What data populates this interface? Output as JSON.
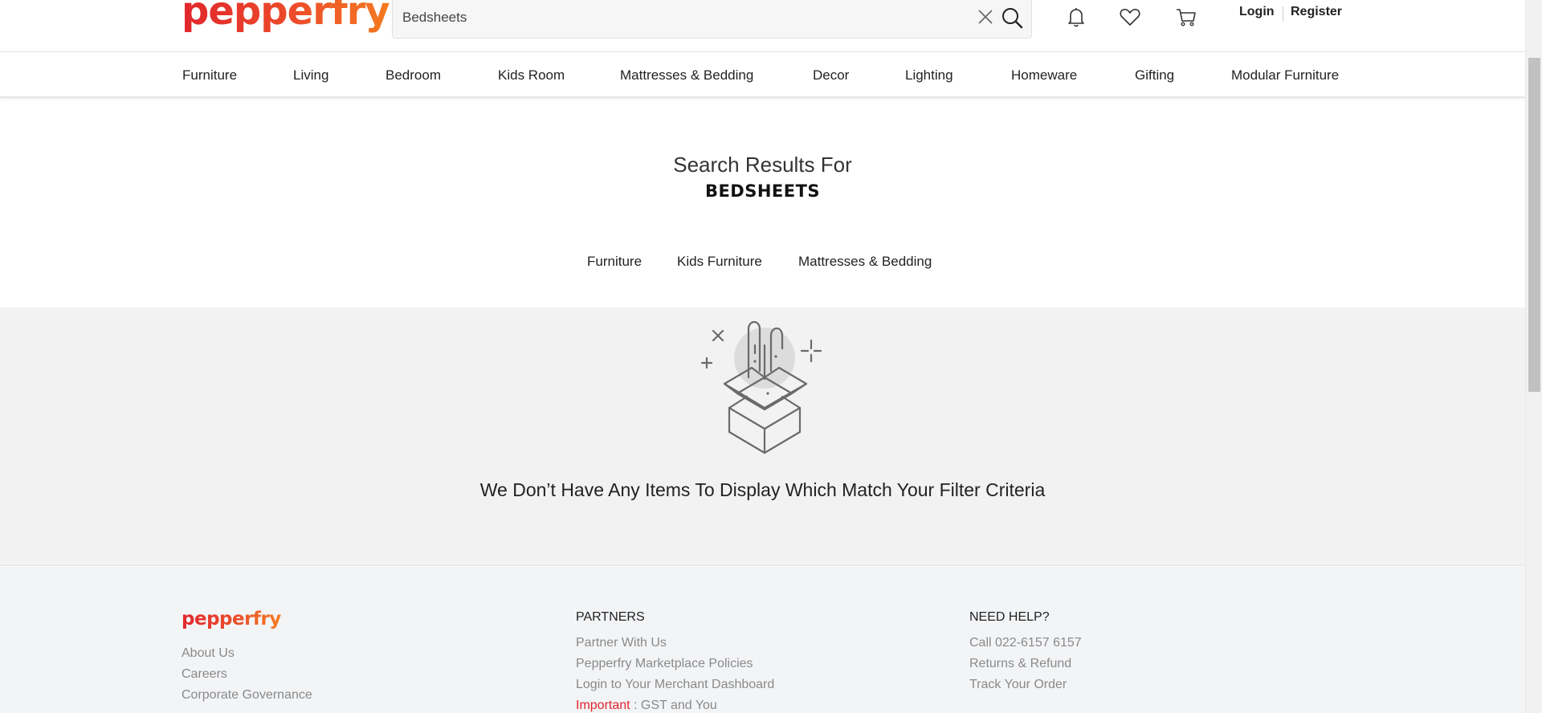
{
  "brand": {
    "logo_text": "pepperfry",
    "colors": {
      "primary": "#e1262d",
      "accent": "#f47b20"
    }
  },
  "header": {
    "search": {
      "value": "Bedsheets",
      "placeholder": "",
      "clear_icon": "close-icon",
      "search_icon": "search-icon"
    },
    "icons": [
      "bell-icon",
      "heart-icon",
      "cart-icon"
    ],
    "login_label": "Login",
    "register_label": "Register"
  },
  "nav": {
    "items": [
      {
        "label": "Furniture"
      },
      {
        "label": "Living"
      },
      {
        "label": "Bedroom"
      },
      {
        "label": "Kids Room"
      },
      {
        "label": "Mattresses & Bedding"
      },
      {
        "label": "Decor"
      },
      {
        "label": "Lighting"
      },
      {
        "label": "Homeware"
      },
      {
        "label": "Gifting"
      },
      {
        "label": "Modular Furniture"
      }
    ]
  },
  "results": {
    "heading": "Search Results For",
    "term": "BEDSHEETS",
    "filters": [
      {
        "label": "Furniture"
      },
      {
        "label": "Kids Furniture"
      },
      {
        "label": "Mattresses & Bedding"
      }
    ]
  },
  "empty_state": {
    "icon": "empty-box-icon",
    "message": "We Don’t Have Any Items To Display Which Match Your Filter Criteria"
  },
  "footer": {
    "logo_text": "pepperfry",
    "col1": {
      "links": [
        "About Us",
        "Careers",
        "Corporate Governance"
      ]
    },
    "col2": {
      "heading": "PARTNERS",
      "links": [
        "Partner With Us",
        "Pepperfry Marketplace Policies",
        "Login to Your Merchant Dashboard"
      ],
      "important_label": "Important",
      "important_text": " : GST and You"
    },
    "col3": {
      "heading": "NEED HELP?",
      "links": [
        "Call 022-6157 6157",
        "Returns & Refund",
        "Track Your Order"
      ]
    }
  }
}
